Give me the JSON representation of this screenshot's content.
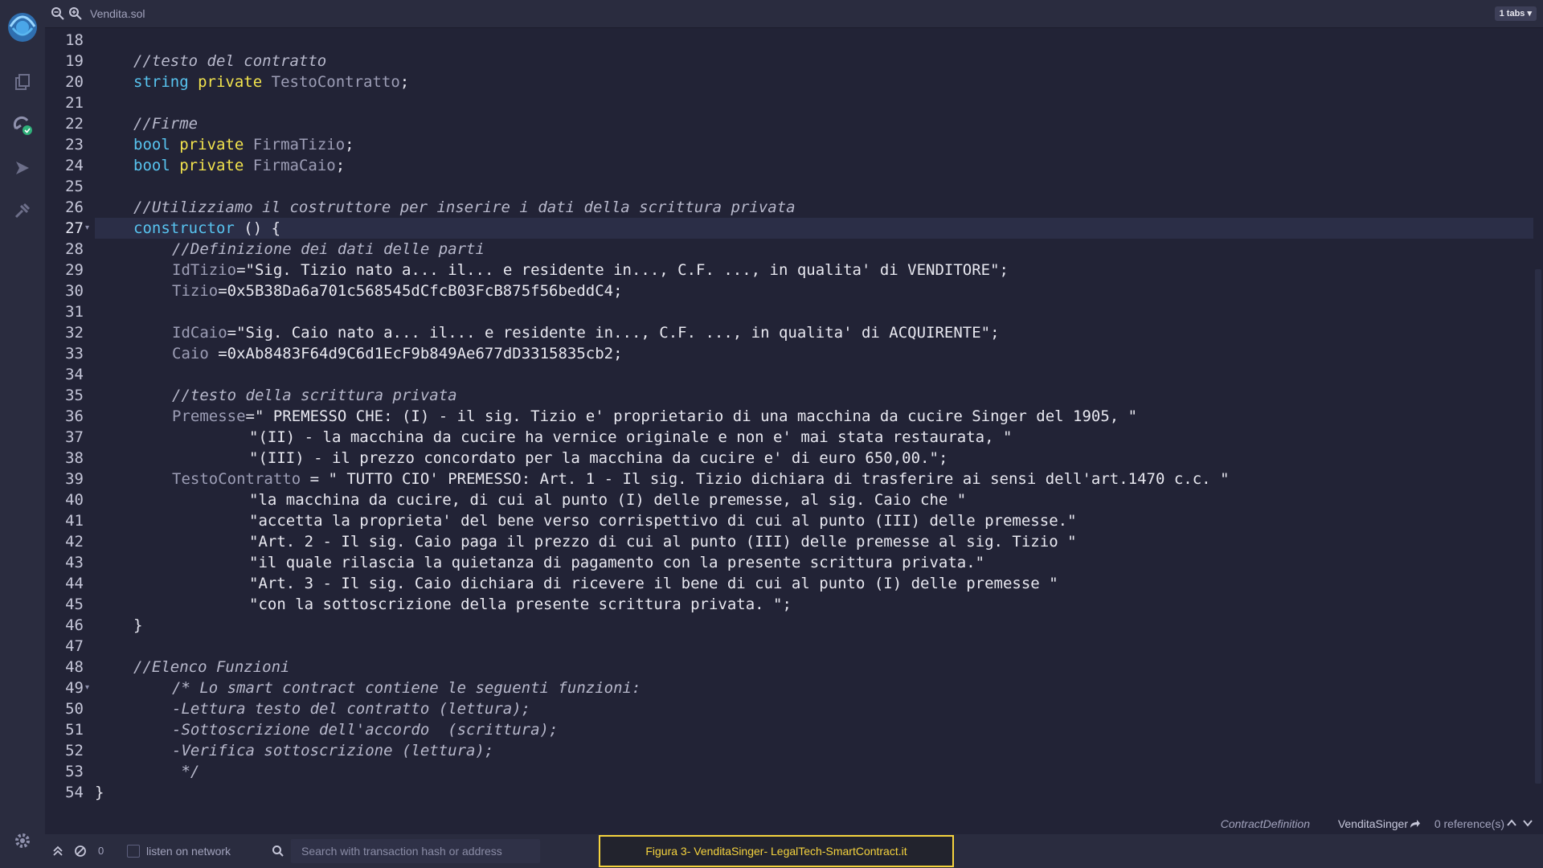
{
  "tab": {
    "file_name": "Vendita.sol",
    "tabs_dropdown": "1 tabs"
  },
  "editor": {
    "active_line": 27,
    "fold_lines": [
      27,
      49
    ],
    "lines": [
      {
        "n": 18,
        "indent": 0,
        "tokens": []
      },
      {
        "n": 19,
        "indent": 1,
        "tokens": [
          {
            "t": "//testo del contratto",
            "c": "cm"
          }
        ]
      },
      {
        "n": 20,
        "indent": 1,
        "tokens": [
          {
            "t": "string",
            "c": "kw"
          },
          {
            "t": " "
          },
          {
            "t": "private",
            "c": "mod"
          },
          {
            "t": " "
          },
          {
            "t": "TestoContratto",
            "c": "var"
          },
          {
            "t": ";",
            "c": "pn"
          }
        ]
      },
      {
        "n": 21,
        "indent": 0,
        "tokens": []
      },
      {
        "n": 22,
        "indent": 1,
        "tokens": [
          {
            "t": "//Firme",
            "c": "cm"
          }
        ]
      },
      {
        "n": 23,
        "indent": 1,
        "tokens": [
          {
            "t": "bool",
            "c": "kw"
          },
          {
            "t": " "
          },
          {
            "t": "private",
            "c": "mod"
          },
          {
            "t": " "
          },
          {
            "t": "FirmaTizio",
            "c": "var"
          },
          {
            "t": ";",
            "c": "pn"
          }
        ]
      },
      {
        "n": 24,
        "indent": 1,
        "tokens": [
          {
            "t": "bool",
            "c": "kw"
          },
          {
            "t": " "
          },
          {
            "t": "private",
            "c": "mod"
          },
          {
            "t": " "
          },
          {
            "t": "FirmaCaio",
            "c": "var"
          },
          {
            "t": ";",
            "c": "pn"
          }
        ]
      },
      {
        "n": 25,
        "indent": 0,
        "tokens": []
      },
      {
        "n": 26,
        "indent": 1,
        "tokens": [
          {
            "t": "//Utilizziamo il costruttore per inserire i dati della scrittura privata",
            "c": "cm"
          }
        ]
      },
      {
        "n": 27,
        "indent": 1,
        "tokens": [
          {
            "t": "constructor",
            "c": "kw"
          },
          {
            "t": " () {",
            "c": "pn"
          }
        ]
      },
      {
        "n": 28,
        "indent": 2,
        "tokens": [
          {
            "t": "//Definizione dei dati delle parti",
            "c": "cm"
          }
        ]
      },
      {
        "n": 29,
        "indent": 2,
        "tokens": [
          {
            "t": "IdTizio",
            "c": "var"
          },
          {
            "t": "=",
            "c": "pn"
          },
          {
            "t": "\"Sig. Tizio nato a... il... e residente in..., C.F. ..., in qualita' di VENDITORE\"",
            "c": "str"
          },
          {
            "t": ";",
            "c": "pn"
          }
        ]
      },
      {
        "n": 30,
        "indent": 2,
        "tokens": [
          {
            "t": "Tizio",
            "c": "var"
          },
          {
            "t": "=0x5B38Da6a701c568545dCfcB03FcB875f56beddC4;",
            "c": "str"
          }
        ]
      },
      {
        "n": 31,
        "indent": 0,
        "tokens": []
      },
      {
        "n": 32,
        "indent": 2,
        "tokens": [
          {
            "t": "IdCaio",
            "c": "var"
          },
          {
            "t": "=",
            "c": "pn"
          },
          {
            "t": "\"Sig. Caio nato a... il... e residente in..., C.F. ..., in qualita' di ACQUIRENTE\"",
            "c": "str"
          },
          {
            "t": ";",
            "c": "pn"
          }
        ]
      },
      {
        "n": 33,
        "indent": 2,
        "tokens": [
          {
            "t": "Caio",
            "c": "var"
          },
          {
            "t": " =0xAb8483F64d9C6d1EcF9b849Ae677dD3315835cb2;",
            "c": "str"
          }
        ]
      },
      {
        "n": 34,
        "indent": 0,
        "tokens": []
      },
      {
        "n": 35,
        "indent": 2,
        "tokens": [
          {
            "t": "//testo della scrittura privata",
            "c": "cm"
          }
        ]
      },
      {
        "n": 36,
        "indent": 2,
        "tokens": [
          {
            "t": "Premesse",
            "c": "var"
          },
          {
            "t": "=",
            "c": "pn"
          },
          {
            "t": "\" PREMESSO CHE: (I) - il sig. Tizio e' proprietario di una macchina da cucire Singer del 1905, \"",
            "c": "str"
          }
        ]
      },
      {
        "n": 37,
        "indent": 4,
        "tokens": [
          {
            "t": "\"(II) - la macchina da cucire ha vernice originale e non e' mai stata restaurata, \"",
            "c": "str"
          }
        ]
      },
      {
        "n": 38,
        "indent": 4,
        "tokens": [
          {
            "t": "\"(III) - il prezzo concordato per la macchina da cucire e' di euro 650,00.\"",
            "c": "str"
          },
          {
            "t": ";",
            "c": "pn"
          }
        ]
      },
      {
        "n": 39,
        "indent": 2,
        "tokens": [
          {
            "t": "TestoContratto",
            "c": "var"
          },
          {
            "t": " = ",
            "c": "pn"
          },
          {
            "t": "\" TUTTO CIO' PREMESSO: Art. 1 - Il sig. Tizio dichiara di trasferire ai sensi dell'art.1470 c.c. \"",
            "c": "str"
          }
        ]
      },
      {
        "n": 40,
        "indent": 4,
        "tokens": [
          {
            "t": "\"la macchina da cucire, di cui al punto (I) delle premesse, al sig. Caio che \"",
            "c": "str"
          }
        ]
      },
      {
        "n": 41,
        "indent": 4,
        "tokens": [
          {
            "t": "\"accetta la proprieta' del bene verso corrispettivo di cui al punto (III) delle premesse.\"",
            "c": "str"
          }
        ]
      },
      {
        "n": 42,
        "indent": 4,
        "tokens": [
          {
            "t": "\"Art. 2 - Il sig. Caio paga il prezzo di cui al punto (III) delle premesse al sig. Tizio \"",
            "c": "str"
          }
        ]
      },
      {
        "n": 43,
        "indent": 4,
        "tokens": [
          {
            "t": "\"il quale rilascia la quietanza di pagamento con la presente scrittura privata.\"",
            "c": "str"
          }
        ]
      },
      {
        "n": 44,
        "indent": 4,
        "tokens": [
          {
            "t": "\"Art. 3 - Il sig. Caio dichiara di ricevere il bene di cui al punto (I) delle premesse \"",
            "c": "str"
          }
        ]
      },
      {
        "n": 45,
        "indent": 4,
        "tokens": [
          {
            "t": "\"con la sottoscrizione della presente scrittura privata. \"",
            "c": "str"
          },
          {
            "t": ";",
            "c": "pn"
          }
        ]
      },
      {
        "n": 46,
        "indent": 1,
        "tokens": [
          {
            "t": "}",
            "c": "pn"
          }
        ]
      },
      {
        "n": 47,
        "indent": 0,
        "tokens": []
      },
      {
        "n": 48,
        "indent": 1,
        "tokens": [
          {
            "t": "//Elenco Funzioni",
            "c": "cm"
          }
        ]
      },
      {
        "n": 49,
        "indent": 2,
        "tokens": [
          {
            "t": "/* Lo smart contract contiene le seguenti funzioni:",
            "c": "cm"
          }
        ]
      },
      {
        "n": 50,
        "indent": 2,
        "tokens": [
          {
            "t": "-Lettura testo del contratto (lettura);",
            "c": "cm"
          }
        ]
      },
      {
        "n": 51,
        "indent": 2,
        "tokens": [
          {
            "t": "-Sottoscrizione dell'accordo  (scrittura);",
            "c": "cm"
          }
        ]
      },
      {
        "n": 52,
        "indent": 2,
        "tokens": [
          {
            "t": "-Verifica sottoscrizione (lettura);",
            "c": "cm"
          }
        ]
      },
      {
        "n": 53,
        "indent": 2,
        "tokens": [
          {
            "t": " */",
            "c": "cm"
          }
        ]
      },
      {
        "n": 54,
        "indent": 0,
        "tokens": [
          {
            "t": "}",
            "c": "pn"
          }
        ]
      }
    ]
  },
  "status": {
    "context_type": "ContractDefinition",
    "context_name": "VenditaSinger",
    "references": "0 reference(s)"
  },
  "terminal": {
    "count": "0",
    "listen_label": "listen on network",
    "search_placeholder": "Search with transaction hash or address"
  },
  "caption": "Figura 3- VenditaSinger- LegalTech-SmartContract.it",
  "colors": {
    "background": "#222336",
    "panel": "#2a2c3f",
    "keyword": "#58c4f0",
    "modifier": "#f2e34d",
    "comment": "#b8b9cc",
    "caption_border": "#f5d33e"
  }
}
